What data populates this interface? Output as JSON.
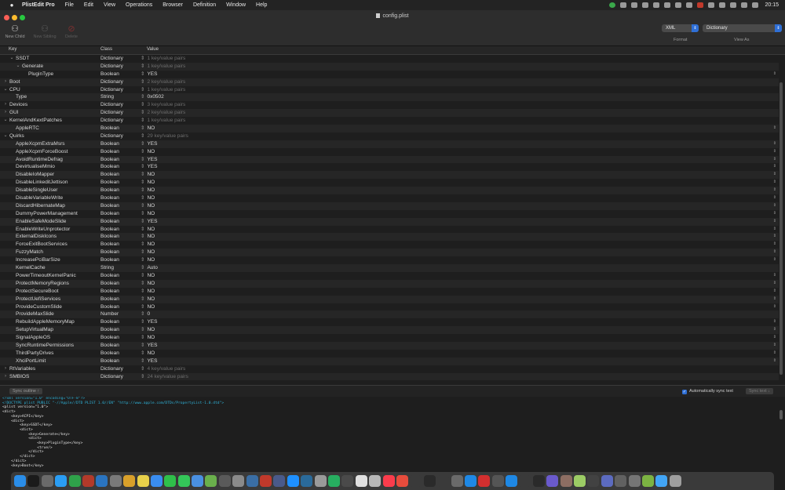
{
  "menubar": {
    "app_name": "PlistEdit Pro",
    "items": [
      "File",
      "Edit",
      "View",
      "Operations",
      "Browser",
      "Definition",
      "Window",
      "Help"
    ],
    "clock": "20:15"
  },
  "window": {
    "title": "config.plist"
  },
  "toolbar": {
    "new_child": "New Child",
    "new_sibling": "New Sibling",
    "delete": "Delete",
    "format_value": "XML",
    "format_label": "Format",
    "viewas_value": "Dictionary",
    "viewas_label": "View As"
  },
  "columns": {
    "key": "Key",
    "class": "Class",
    "value": "Value"
  },
  "rows": [
    {
      "key": "SSDT",
      "class": "Dictionary",
      "value": "1 key/value pairs",
      "depth": 1,
      "disc": "open",
      "summary": true
    },
    {
      "key": "Generate",
      "class": "Dictionary",
      "value": "1 key/value pairs",
      "depth": 2,
      "disc": "open",
      "summary": true
    },
    {
      "key": "PluginType",
      "class": "Boolean",
      "value": "YES",
      "depth": 3,
      "disc": "",
      "summary": false
    },
    {
      "key": "Boot",
      "class": "Dictionary",
      "value": "2 key/value pairs",
      "depth": 0,
      "disc": "closed",
      "summary": true
    },
    {
      "key": "CPU",
      "class": "Dictionary",
      "value": "1 key/value pairs",
      "depth": 0,
      "disc": "open",
      "summary": true
    },
    {
      "key": "Type",
      "class": "String",
      "value": "0x0502",
      "depth": 1,
      "disc": "",
      "summary": false
    },
    {
      "key": "Devices",
      "class": "Dictionary",
      "value": "3 key/value pairs",
      "depth": 0,
      "disc": "closed",
      "summary": true
    },
    {
      "key": "GUI",
      "class": "Dictionary",
      "value": "2 key/value pairs",
      "depth": 0,
      "disc": "closed",
      "summary": true
    },
    {
      "key": "KernelAndKextPatches",
      "class": "Dictionary",
      "value": "1 key/value pairs",
      "depth": 0,
      "disc": "open",
      "summary": true
    },
    {
      "key": "AppleRTC",
      "class": "Boolean",
      "value": "NO",
      "depth": 1,
      "disc": "",
      "summary": false
    },
    {
      "key": "Quirks",
      "class": "Dictionary",
      "value": "29 key/value pairs",
      "depth": 0,
      "disc": "open",
      "summary": true
    },
    {
      "key": "AppleXcpmExtraMsrs",
      "class": "Boolean",
      "value": "YES",
      "depth": 1,
      "disc": "",
      "summary": false
    },
    {
      "key": "AppleXcpmForceBoost",
      "class": "Boolean",
      "value": "NO",
      "depth": 1,
      "disc": "",
      "summary": false
    },
    {
      "key": "AvoidRuntimeDefrag",
      "class": "Boolean",
      "value": "YES",
      "depth": 1,
      "disc": "",
      "summary": false
    },
    {
      "key": "DevirtualiseMmio",
      "class": "Boolean",
      "value": "YES",
      "depth": 1,
      "disc": "",
      "summary": false
    },
    {
      "key": "DisableIoMapper",
      "class": "Boolean",
      "value": "NO",
      "depth": 1,
      "disc": "",
      "summary": false
    },
    {
      "key": "DisableLinkeditJettison",
      "class": "Boolean",
      "value": "NO",
      "depth": 1,
      "disc": "",
      "summary": false
    },
    {
      "key": "DisableSingleUser",
      "class": "Boolean",
      "value": "NO",
      "depth": 1,
      "disc": "",
      "summary": false
    },
    {
      "key": "DisableVariableWrite",
      "class": "Boolean",
      "value": "NO",
      "depth": 1,
      "disc": "",
      "summary": false
    },
    {
      "key": "DiscardHibernateMap",
      "class": "Boolean",
      "value": "NO",
      "depth": 1,
      "disc": "",
      "summary": false
    },
    {
      "key": "DummyPowerManagement",
      "class": "Boolean",
      "value": "NO",
      "depth": 1,
      "disc": "",
      "summary": false
    },
    {
      "key": "EnableSafeModeSlide",
      "class": "Boolean",
      "value": "YES",
      "depth": 1,
      "disc": "",
      "summary": false
    },
    {
      "key": "EnableWriteUnprotector",
      "class": "Boolean",
      "value": "NO",
      "depth": 1,
      "disc": "",
      "summary": false
    },
    {
      "key": "ExternalDiskIcons",
      "class": "Boolean",
      "value": "NO",
      "depth": 1,
      "disc": "",
      "summary": false
    },
    {
      "key": "ForceExitBootServices",
      "class": "Boolean",
      "value": "NO",
      "depth": 1,
      "disc": "",
      "summary": false
    },
    {
      "key": "FuzzyMatch",
      "class": "Boolean",
      "value": "NO",
      "depth": 1,
      "disc": "",
      "summary": false
    },
    {
      "key": "IncreasePciBarSize",
      "class": "Boolean",
      "value": "NO",
      "depth": 1,
      "disc": "",
      "summary": false
    },
    {
      "key": "KernelCache",
      "class": "String",
      "value": "Auto",
      "depth": 1,
      "disc": "",
      "summary": false
    },
    {
      "key": "PowerTimeoutKernelPanic",
      "class": "Boolean",
      "value": "NO",
      "depth": 1,
      "disc": "",
      "summary": false
    },
    {
      "key": "ProtectMemoryRegions",
      "class": "Boolean",
      "value": "NO",
      "depth": 1,
      "disc": "",
      "summary": false
    },
    {
      "key": "ProtectSecureBoot",
      "class": "Boolean",
      "value": "NO",
      "depth": 1,
      "disc": "",
      "summary": false
    },
    {
      "key": "ProtectUefiServices",
      "class": "Boolean",
      "value": "NO",
      "depth": 1,
      "disc": "",
      "summary": false
    },
    {
      "key": "ProvideCustomSlide",
      "class": "Boolean",
      "value": "NO",
      "depth": 1,
      "disc": "",
      "summary": false
    },
    {
      "key": "ProvideMaxSlide",
      "class": "Number",
      "value": "0",
      "depth": 1,
      "disc": "",
      "summary": false
    },
    {
      "key": "RebuildAppleMemoryMap",
      "class": "Boolean",
      "value": "YES",
      "depth": 1,
      "disc": "",
      "summary": false
    },
    {
      "key": "SetupVirtualMap",
      "class": "Boolean",
      "value": "NO",
      "depth": 1,
      "disc": "",
      "summary": false
    },
    {
      "key": "SignalAppleOS",
      "class": "Boolean",
      "value": "NO",
      "depth": 1,
      "disc": "",
      "summary": false
    },
    {
      "key": "SyncRuntimePermissions",
      "class": "Boolean",
      "value": "YES",
      "depth": 1,
      "disc": "",
      "summary": false
    },
    {
      "key": "ThirdPartyDrives",
      "class": "Boolean",
      "value": "NO",
      "depth": 1,
      "disc": "",
      "summary": false
    },
    {
      "key": "XhciPortLimit",
      "class": "Boolean",
      "value": "YES",
      "depth": 1,
      "disc": "",
      "summary": false
    },
    {
      "key": "RtVariables",
      "class": "Dictionary",
      "value": "4 key/value pairs",
      "depth": 0,
      "disc": "closed",
      "summary": true
    },
    {
      "key": "SMBIOS",
      "class": "Dictionary",
      "value": "24 key/value pairs",
      "depth": 0,
      "disc": "closed",
      "summary": true
    }
  ],
  "sync": {
    "outline_button": "Sync outline ↑",
    "auto_sync_label": "Automatically sync text",
    "sync_text_button": "Sync text ↓"
  },
  "xml_lines": [
    {
      "t": "<?xml version=\"1.0\" encoding=\"UTF-8\"?>",
      "kind": "pi"
    },
    {
      "t": "<!DOCTYPE plist PUBLIC \"-//Apple//DTD PLIST 1.0//EN\" \"http://www.apple.com/DTDs/PropertyList-1.0.dtd\">",
      "kind": "pi"
    },
    {
      "t": "<plist version=\"1.0\">",
      "kind": "tag"
    },
    {
      "t": "<dict>",
      "kind": "tag"
    },
    {
      "t": "    <key>ACPI</key>",
      "kind": "tag"
    },
    {
      "t": "    <dict>",
      "kind": "tag"
    },
    {
      "t": "        <key>SSDT</key>",
      "kind": "tag"
    },
    {
      "t": "        <dict>",
      "kind": "tag"
    },
    {
      "t": "            <key>Generate</key>",
      "kind": "tag"
    },
    {
      "t": "            <dict>",
      "kind": "tag"
    },
    {
      "t": "                <key>PluginType</key>",
      "kind": "tag"
    },
    {
      "t": "                <true/>",
      "kind": "tag"
    },
    {
      "t": "            </dict>",
      "kind": "tag"
    },
    {
      "t": "        </dict>",
      "kind": "tag"
    },
    {
      "t": "    </dict>",
      "kind": "tag"
    },
    {
      "t": "    <key>Boot</key>",
      "kind": "tag"
    }
  ],
  "colors": {
    "accent": "#2f6fd6",
    "close": "#fe5f57",
    "minimize": "#febc2e",
    "zoom": "#28c840"
  },
  "dock_icons": [
    {
      "name": "finder-icon",
      "color": "#2a8de8"
    },
    {
      "name": "terminal-icon",
      "color": "#1b1b1b"
    },
    {
      "name": "launchpad-icon",
      "color": "#6a6a6a"
    },
    {
      "name": "safari-icon",
      "color": "#2a9df4"
    },
    {
      "name": "chrome-icon",
      "color": "#2fa24a"
    },
    {
      "name": "xcode-icon",
      "color": "#b23a2a"
    },
    {
      "name": "activity-monitor-icon",
      "color": "#2a74c0"
    },
    {
      "name": "system-preferences-icon",
      "color": "#7a7a7a"
    },
    {
      "name": "package-icon",
      "color": "#d9a02a"
    },
    {
      "name": "photos-icon",
      "color": "#e8d04a"
    },
    {
      "name": "mail-icon",
      "color": "#3a8df0"
    },
    {
      "name": "facetime-icon",
      "color": "#2fbf4a"
    },
    {
      "name": "messages-icon",
      "color": "#34c759"
    },
    {
      "name": "preview-icon",
      "color": "#4a90e2"
    },
    {
      "name": "maps-icon",
      "color": "#6ab04c"
    },
    {
      "name": "network-icon",
      "color": "#5a5a5a"
    },
    {
      "name": "disk-utility-icon",
      "color": "#8a8a8a"
    },
    {
      "name": "migration-icon",
      "color": "#3a6ea5"
    },
    {
      "name": "dictionary-icon",
      "color": "#c0392b"
    },
    {
      "name": "box-icon",
      "color": "#4a5a8a"
    },
    {
      "name": "app-store-icon",
      "color": "#1e90ff"
    },
    {
      "name": "cube-icon",
      "color": "#2a6a9a"
    },
    {
      "name": "tools-icon",
      "color": "#9a9a9a"
    },
    {
      "name": "script-editor-icon",
      "color": "#27ae60"
    },
    {
      "name": "grapher-icon",
      "color": "#4a4a4a"
    },
    {
      "name": "notes-icon",
      "color": "#e0e0e0"
    },
    {
      "name": "stickies-icon",
      "color": "#b8b8b8"
    },
    {
      "name": "music-icon",
      "color": "#fa3c4c"
    },
    {
      "name": "photo-booth-icon",
      "color": "#e74c3c"
    },
    {
      "name": "numbers-icon",
      "color": "#3a3a3a"
    },
    {
      "name": "console-icon",
      "color": "#2a2a2a"
    },
    {
      "name": "calculator-icon",
      "color": "#3a3a3a"
    },
    {
      "name": "font-book-icon",
      "color": "#6a6a6a"
    },
    {
      "name": "shortcuts-icon",
      "color": "#1e88e5"
    },
    {
      "name": "pdf-icon",
      "color": "#d32f2f"
    },
    {
      "name": "unity-icon",
      "color": "#555555"
    },
    {
      "name": "swift-icon",
      "color": "#1e88e5"
    },
    {
      "name": "hackintool-icon",
      "color": "#3a3a3a"
    },
    {
      "name": "ssh-icon",
      "color": "#2a2a2a"
    },
    {
      "name": "virtualbox-icon",
      "color": "#6a5acd"
    },
    {
      "name": "coffee-icon",
      "color": "#8d6e63"
    },
    {
      "name": "magnifier-icon",
      "color": "#9ccc65"
    },
    {
      "name": "settings-gear-icon",
      "color": "#424242"
    },
    {
      "name": "iphone-backup-icon",
      "color": "#5c6bc0"
    },
    {
      "name": "image-capture-icon",
      "color": "#616161"
    },
    {
      "name": "clock-icon",
      "color": "#757575"
    },
    {
      "name": "android-icon",
      "color": "#7cb342"
    },
    {
      "name": "folder-icon",
      "color": "#42a5f5"
    },
    {
      "name": "trash-icon",
      "color": "#9e9e9e"
    }
  ]
}
